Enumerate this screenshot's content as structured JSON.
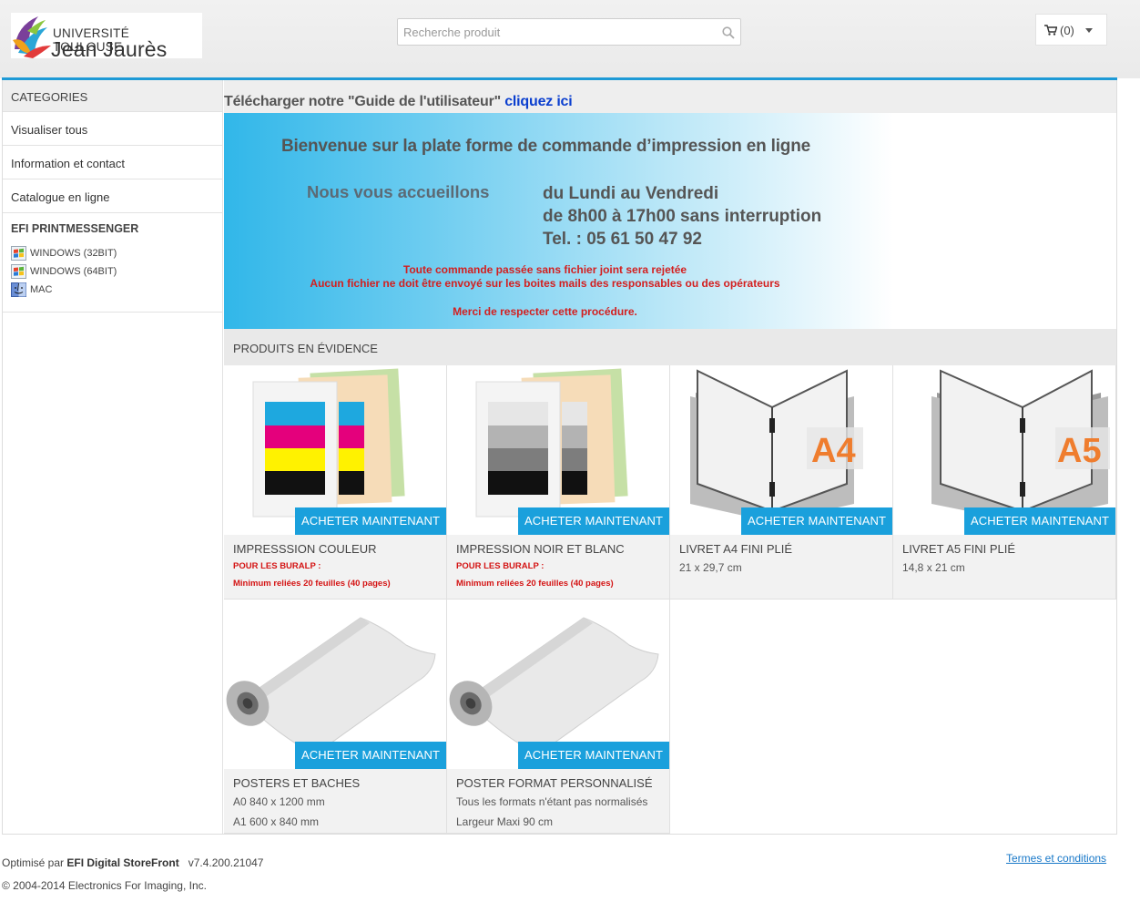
{
  "header": {
    "logo_line1": "UNIVERSITÉ TOULOUSE",
    "logo_line2": "Jean Jaurès",
    "search_placeholder": "Recherche produit",
    "cart_count": "(0)"
  },
  "sidebar": {
    "heading": "CATEGORIES",
    "items": [
      "Visualiser tous",
      "Information et contact",
      "Catalogue en ligne"
    ],
    "efi": {
      "title": "EFI PRINTMESSENGER",
      "downloads": [
        {
          "label": "WINDOWS (32BIT)",
          "icon": "windows-icon"
        },
        {
          "label": "WINDOWS (64BIT)",
          "icon": "windows-icon"
        },
        {
          "label": "MAC",
          "icon": "mac-finder-icon"
        }
      ]
    }
  },
  "guide": {
    "text": "Télécharger notre \"Guide de l'utilisateur\"",
    "link": "cliquez ici"
  },
  "banner": {
    "title": "Bienvenue sur la plate forme de commande d’impression en ligne",
    "welcome": "Nous vous accueillons",
    "hours1": "du Lundi au Vendredi",
    "hours2": "de 8h00 à 17h00 sans interruption",
    "phone": "Tel. : 05 61 50 47 92",
    "warning1": "Toute commande passée sans fichier joint sera rejetée",
    "warning2": "Aucun fichier ne doit être envoyé sur les boites mails des responsables ou des opérateurs",
    "warning3": "Merci de respecter cette procédure."
  },
  "featured": {
    "heading": "PRODUITS EN ÉVIDENCE",
    "buy_label": "ACHETER MAINTENANT",
    "products": [
      {
        "title": "IMPRESSSION COULEUR",
        "red1": "POUR LES BURALP :",
        "red2": "Minimum reliées 20 feuilles (40 pages)",
        "image": "color-print"
      },
      {
        "title": "IMPRESSION NOIR ET BLANC",
        "red1": "POUR LES BURALP :",
        "red2": "Minimum reliées 20 feuilles (40 pages)",
        "image": "bw-print"
      },
      {
        "title": "LIVRET A4 FINI PLIÉ",
        "sub1": "21 x 29,7 cm",
        "image": "booklet",
        "badge": "A4"
      },
      {
        "title": "LIVRET A5 FINI PLIÉ",
        "sub1": "14,8 x 21 cm",
        "image": "booklet",
        "badge": "A5"
      },
      {
        "title": "POSTERS ET BACHES",
        "sub1": "A0  840 x 1200 mm",
        "sub2": "A1  600 x 840 mm",
        "image": "roll"
      },
      {
        "title": "POSTER FORMAT PERSONNALISÉ",
        "sub1": "Tous les formats n'étant pas normalisés",
        "sub2": "Largeur Maxi 90 cm",
        "image": "roll"
      }
    ]
  },
  "footer": {
    "optimized_prefix": "Optimisé par",
    "optimized_brand": "EFI Digital StoreFront",
    "version": "v7.4.200.21047",
    "copyright": "© 2004-2014 Electronics For Imaging, Inc.",
    "terms": "Termes et conditions"
  },
  "colors": {
    "accent": "#1aa0dc",
    "link": "#0b3fcf",
    "warning": "#d41414"
  }
}
